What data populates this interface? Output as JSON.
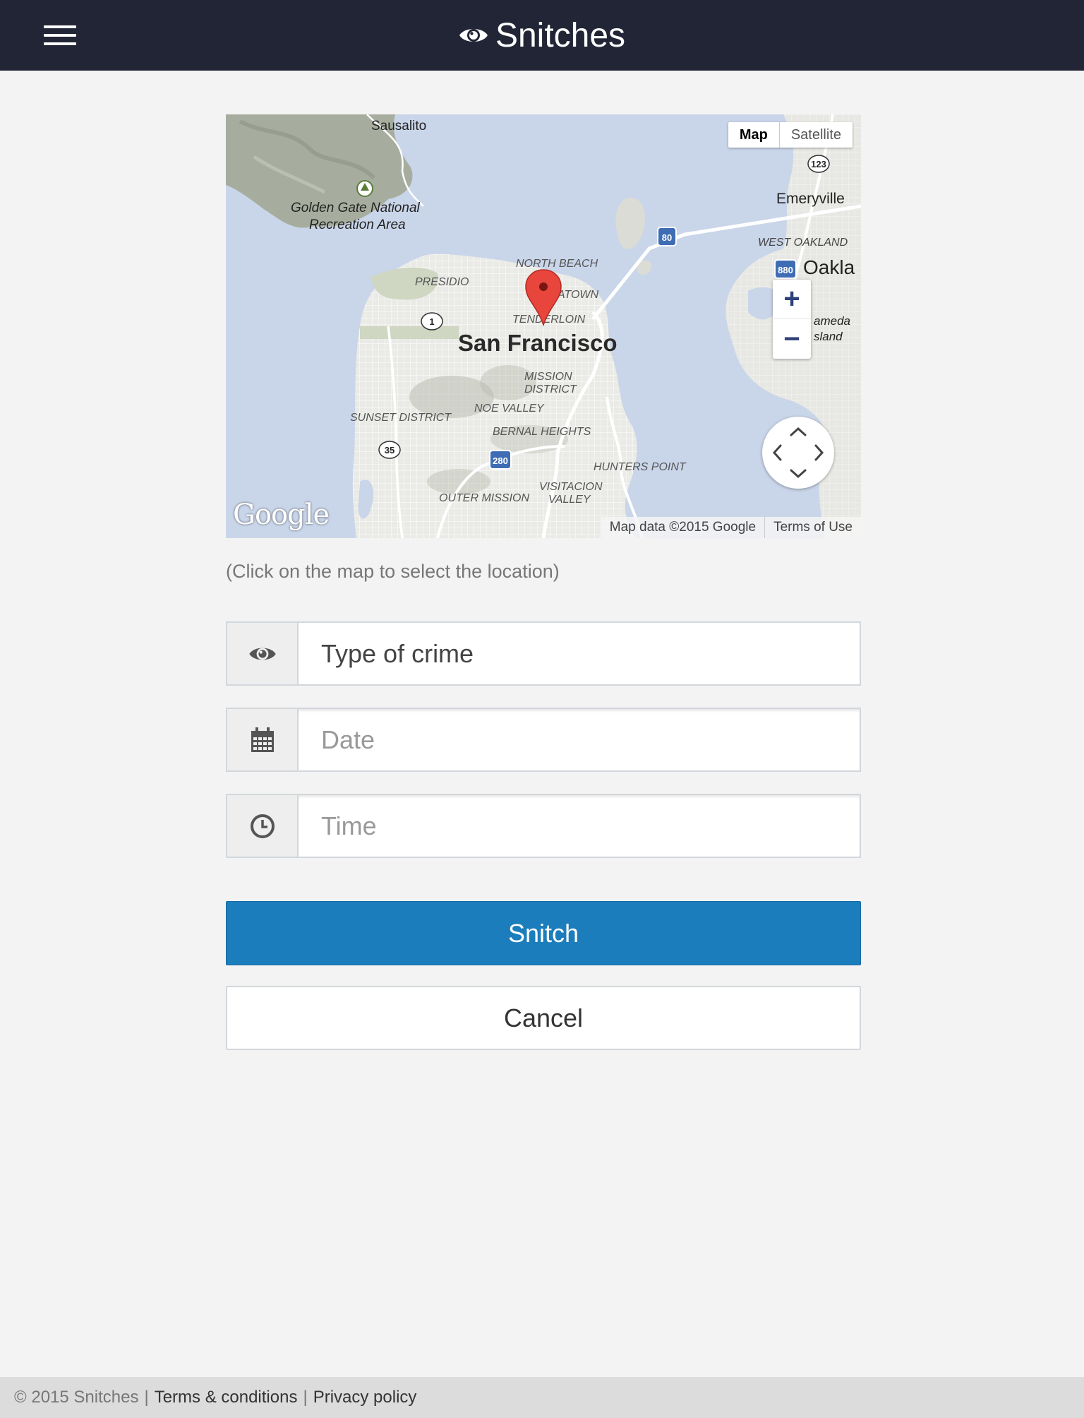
{
  "header": {
    "brand": "Snitches",
    "menu_icon": "hamburger-icon",
    "brand_icon": "eye-icon",
    "bg_color": "#212535"
  },
  "map": {
    "map_button": "Map",
    "satellite_button": "Satellite",
    "zoom_in": "+",
    "zoom_out": "−",
    "logo": "Google",
    "attribution": "Map data ©2015 Google",
    "terms": "Terms of Use",
    "labels": {
      "sausalito": "Sausalito",
      "ggnra_1": "Golden Gate National",
      "ggnra_2": "Recreation Area",
      "emeryville": "Emeryville",
      "west_oakland": "WEST OAKLAND",
      "oakland": "Oakla",
      "alameda_1": "ameda",
      "alameda_2": "sland",
      "north_beach": "NORTH BEACH",
      "presidio": "PRESIDIO",
      "chinatown": "ATOWN",
      "tenderloin": "TENDERLOIN",
      "city": "San Francisco",
      "mission_1": "MISSION",
      "mission_2": "DISTRICT",
      "sunset": "SUNSET DISTRICT",
      "noe_valley": "NOE VALLEY",
      "bernal": "BERNAL HEIGHTS",
      "hunters_point": "HUNTERS POINT",
      "visitacion_1": "VISITACION",
      "visitacion_2": "VALLEY",
      "outer_mission": "OUTER MISSION",
      "hw_123": "123",
      "hw_80": "80",
      "hw_880": "880",
      "hw_1": "1",
      "hw_35": "35",
      "hw_280": "280"
    }
  },
  "hint": "(Click on the map to select the location)",
  "form": {
    "crime": {
      "icon": "eye-icon",
      "placeholder": "Type of crime"
    },
    "date": {
      "icon": "calendar-icon",
      "placeholder": "Date"
    },
    "time": {
      "icon": "clock-icon",
      "placeholder": "Time"
    }
  },
  "buttons": {
    "submit": "Snitch",
    "cancel": "Cancel",
    "primary_color": "#1c7dbc"
  },
  "footer": {
    "copyright": "© 2015 Snitches",
    "separator": "|",
    "terms": "Terms & conditions",
    "privacy": "Privacy policy"
  }
}
